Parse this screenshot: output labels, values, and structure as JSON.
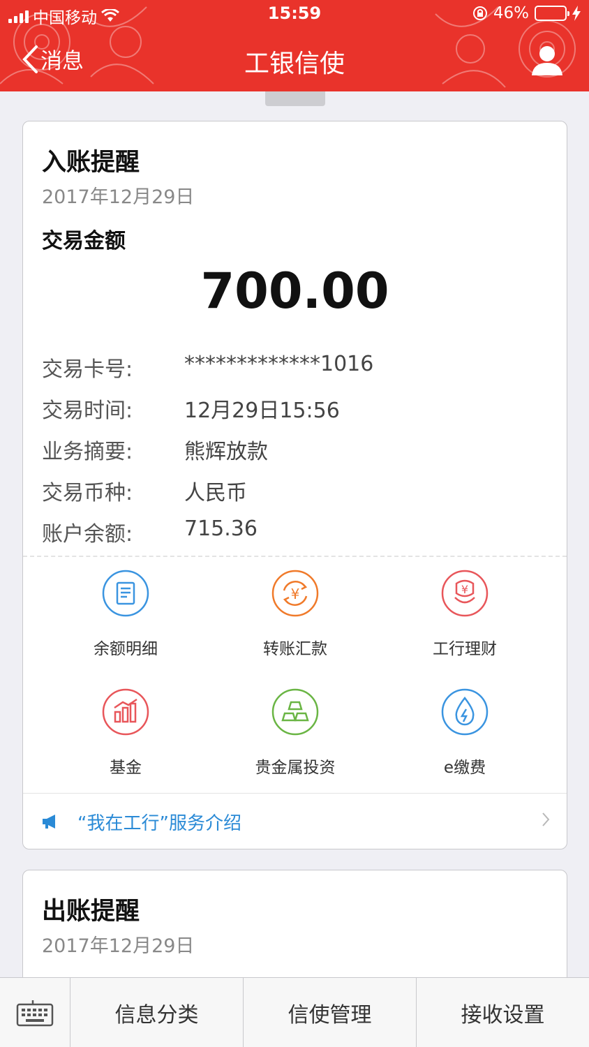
{
  "status_bar": {
    "carrier": "中国移动",
    "time": "15:59",
    "battery": "46%",
    "battery_level": 0.46
  },
  "nav": {
    "back_label": "消息",
    "title": "工银信使"
  },
  "cards": [
    {
      "title": "入账提醒",
      "date": "2017年12月29日",
      "amount_label": "交易金额",
      "amount": "700.00",
      "details": [
        {
          "key": "交易卡号:",
          "value": "*************1016"
        },
        {
          "key": "交易时间:",
          "value": "12月29日15:56"
        },
        {
          "key": "业务摘要:",
          "value": "熊辉放款"
        },
        {
          "key": "交易币种:",
          "value": "人民币"
        },
        {
          "key": "账户余额:",
          "value": "715.36"
        }
      ],
      "services": [
        {
          "label": "余额明细",
          "icon": "document-icon",
          "color": "#3a94e0"
        },
        {
          "label": "转账汇款",
          "icon": "yuan-exchange-icon",
          "color": "#f07a2a"
        },
        {
          "label": "工行理财",
          "icon": "flower-yuan-icon",
          "color": "#e8565a"
        },
        {
          "label": "基金",
          "icon": "bar-chart-icon",
          "color": "#e8565a"
        },
        {
          "label": "贵金属投资",
          "icon": "gold-bars-icon",
          "color": "#6ab544"
        },
        {
          "label": "e缴费",
          "icon": "water-drop-icon",
          "color": "#3a94e0"
        }
      ],
      "intro": "“我在工行”服务介绍"
    },
    {
      "title": "出账提醒",
      "date": "2017年12月29日"
    }
  ],
  "bottom_bar": {
    "tabs": [
      "信息分类",
      "信使管理",
      "接收设置"
    ]
  },
  "colors": {
    "header": "#e9332b",
    "link": "#2a8ad6"
  }
}
